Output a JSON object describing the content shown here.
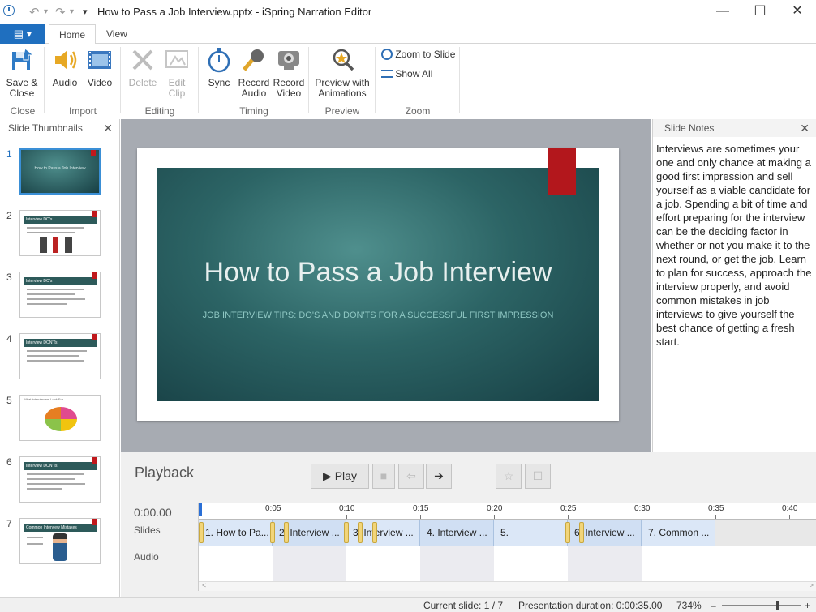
{
  "window": {
    "title": "How to Pass a Job Interview.pptx - iSpring Narration Editor",
    "minimize": "—",
    "maximize": "☐",
    "close": "✕"
  },
  "qat": {
    "undo": "↶",
    "redo": "↷",
    "more": "▾"
  },
  "tabs": {
    "file": "▤ ▾",
    "home": "Home",
    "view": "View"
  },
  "ribbon": {
    "save_close": "Save &\nClose",
    "audio": "Audio",
    "video": "Video",
    "delete": "Delete",
    "edit_clip": "Edit\nClip",
    "sync": "Sync",
    "record_audio": "Record\nAudio",
    "record_video": "Record\nVideo",
    "preview_animations": "Preview with\nAnimations",
    "zoom_to_slide": "Zoom to Slide",
    "show_all": "Show All",
    "groups": {
      "close": "Close",
      "import": "Import",
      "editing": "Editing",
      "timing": "Timing",
      "preview": "Preview",
      "zoom": "Zoom"
    }
  },
  "thumbnails": {
    "header": "Slide Thumbnails",
    "close": "✕",
    "items": [
      {
        "num": "1",
        "selected": true
      },
      {
        "num": "2"
      },
      {
        "num": "3"
      },
      {
        "num": "4"
      },
      {
        "num": "5"
      },
      {
        "num": "6"
      },
      {
        "num": "7"
      }
    ],
    "thumb1_title": "How to Pass a Job Interview",
    "thumb2_title": "Interview DO's",
    "thumb3_title": "Interview DO's",
    "thumb4_title": "Interview DON'Ts",
    "thumb6_title": "Interview DON'Ts",
    "thumb7_title": "Common Interview Mistakes",
    "thumb5_title": "What Interviewers Look For"
  },
  "slide": {
    "title": "How to Pass a Job Interview",
    "subtitle": "JOB INTERVIEW TIPS: DO'S AND DON'TS FOR A SUCCESSFUL FIRST IMPRESSION"
  },
  "notes": {
    "header": "Slide Notes",
    "close": "✕",
    "text": "Interviews are sometimes your one and only chance at making a good first impression and sell yourself as a viable candidate for a job. Spending a bit of time and effort preparing for the interview can be the deciding factor in whether or not you make it to the next round, or get the job. Learn to plan for success, approach the interview properly, and avoid common mistakes in job interviews to give yourself the best chance of getting a fresh start."
  },
  "playback": {
    "title": "Playback",
    "play": "▶  Play",
    "stop": "■",
    "prev": "⇦",
    "next": "➔",
    "star": "☆",
    "box": "☐",
    "time": "0:00.00",
    "slides_label": "Slides",
    "audio_label": "Audio",
    "ticks": [
      "0:05",
      "0:10",
      "0:15",
      "0:20",
      "0:25",
      "0:30",
      "0:35",
      "0:40"
    ],
    "segments": [
      "1. How to Pa...",
      "2. Interview ...",
      "3. Interview ...",
      "4. Interview ...",
      "5.",
      "6. Interview ...",
      "7. Common ..."
    ],
    "scroll_left": "<",
    "scroll_right": ">"
  },
  "status": {
    "current_slide": "Current slide: 1 / 7",
    "duration": "Presentation duration: 0:00:35.00",
    "zoom": "734%",
    "minus": "–",
    "plus": "+"
  }
}
